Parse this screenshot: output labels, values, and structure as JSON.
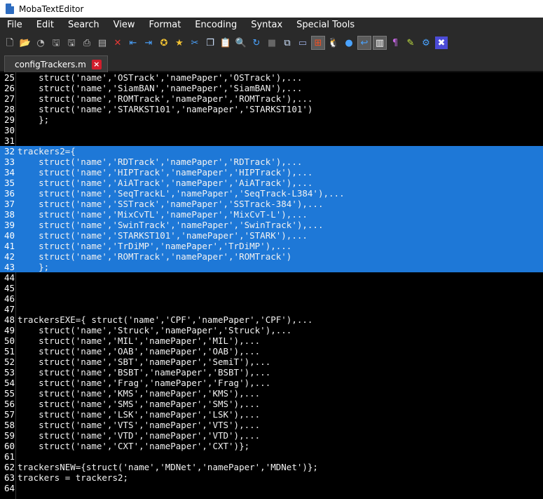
{
  "window": {
    "title": "MobaTextEditor"
  },
  "menu": [
    "File",
    "Edit",
    "Search",
    "View",
    "Format",
    "Encoding",
    "Syntax",
    "Special Tools"
  ],
  "toolbar": [
    {
      "name": "new-file-icon",
      "glyph": "🗋",
      "color": "#e8e8e8"
    },
    {
      "name": "open-folder-icon",
      "glyph": "📂",
      "color": "#e8b84a"
    },
    {
      "name": "reload-icon",
      "glyph": "◔",
      "color": "#bbbbbb"
    },
    {
      "name": "save-icon",
      "glyph": "🖫",
      "color": "#aaaaaa"
    },
    {
      "name": "save-all-icon",
      "glyph": "🖫",
      "color": "#bbbbbb"
    },
    {
      "name": "print-icon",
      "glyph": "⎙",
      "color": "#cccccc"
    },
    {
      "name": "print-preview-icon",
      "glyph": "▤",
      "color": "#bbbbbb"
    },
    {
      "name": "close-file-icon",
      "glyph": "✕",
      "color": "#e53935"
    },
    {
      "name": "unindent-icon",
      "glyph": "⇤",
      "color": "#4aa3ff"
    },
    {
      "name": "indent-icon",
      "glyph": "⇥",
      "color": "#4aa3ff"
    },
    {
      "name": "bookmark-toggle-icon",
      "glyph": "✪",
      "color": "#f2c233"
    },
    {
      "name": "bookmark-star-icon",
      "glyph": "★",
      "color": "#f2c233"
    },
    {
      "name": "cut-icon",
      "glyph": "✂",
      "color": "#4aa3ff"
    },
    {
      "name": "copy-icon",
      "glyph": "❐",
      "color": "#cfe3ff"
    },
    {
      "name": "paste-icon",
      "glyph": "📋",
      "color": "#d8c48a"
    },
    {
      "name": "find-icon",
      "glyph": "🔍",
      "color": "#cfe3ff"
    },
    {
      "name": "replace-icon",
      "glyph": "↻",
      "color": "#4aa3ff"
    },
    {
      "name": "goto-icon",
      "glyph": "■",
      "color": "#666666"
    },
    {
      "name": "compare-icon",
      "glyph": "⧉",
      "color": "#cfe3ff"
    },
    {
      "name": "view-mode-icon",
      "glyph": "▭",
      "color": "#9ad"
    },
    {
      "name": "windows-format-icon",
      "glyph": "⊞",
      "color": "#f25022",
      "active": true
    },
    {
      "name": "linux-format-icon",
      "glyph": "🐧",
      "color": "#ffffff"
    },
    {
      "name": "mac-format-icon",
      "glyph": "●",
      "color": "#4aa3ff"
    },
    {
      "name": "word-wrap-icon",
      "glyph": "↩",
      "color": "#4aa3ff",
      "active": true
    },
    {
      "name": "split-view-icon",
      "glyph": "▥",
      "color": "#ffffff",
      "active": true
    },
    {
      "name": "show-special-chars-icon",
      "glyph": "¶",
      "color": "#c266e0"
    },
    {
      "name": "highlight-icon",
      "glyph": "✎",
      "color": "#c0e040"
    },
    {
      "name": "settings-icon",
      "glyph": "⚙",
      "color": "#4aa3ff"
    },
    {
      "name": "exit-icon",
      "glyph": "✖",
      "color": "#ffffff",
      "bg": "#4b4bd6"
    }
  ],
  "tabs": [
    {
      "label": "configTrackers.m",
      "close": "×"
    }
  ],
  "editor": {
    "lines": [
      {
        "n": "25",
        "text": "    struct('name','OSTrack','namePaper','OSTrack'),...",
        "sel": false
      },
      {
        "n": "26",
        "text": "    struct('name','SiamBAN','namePaper','SiamBAN'),...",
        "sel": false
      },
      {
        "n": "27",
        "text": "    struct('name','ROMTrack','namePaper','ROMTrack'),...",
        "sel": false
      },
      {
        "n": "28",
        "text": "    struct('name','STARKST101','namePaper','STARKST101')",
        "sel": false
      },
      {
        "n": "29",
        "text": "    };",
        "sel": false
      },
      {
        "n": "30",
        "text": "",
        "sel": false
      },
      {
        "n": "31",
        "text": "",
        "sel": false
      },
      {
        "n": "32",
        "text": "trackers2={",
        "sel": true
      },
      {
        "n": "33",
        "text": "    struct('name','RDTrack','namePaper','RDTrack'),...",
        "sel": true
      },
      {
        "n": "34",
        "text": "    struct('name','HIPTrack','namePaper','HIPTrack'),...",
        "sel": true
      },
      {
        "n": "35",
        "text": "    struct('name','AiATrack','namePaper','AiATrack'),...",
        "sel": true
      },
      {
        "n": "36",
        "text": "    struct('name','SeqTrackL','namePaper','SeqTrack-L384'),...",
        "sel": true
      },
      {
        "n": "37",
        "text": "    struct('name','SSTrack','namePaper','SSTrack-384'),...",
        "sel": true
      },
      {
        "n": "38",
        "text": "    struct('name','MixCvTL','namePaper','MixCvT-L'),...",
        "sel": true
      },
      {
        "n": "39",
        "text": "    struct('name','SwinTrack','namePaper','SwinTrack'),...",
        "sel": true
      },
      {
        "n": "40",
        "text": "    struct('name','STARKST101','namePaper','STARK'),...",
        "sel": true
      },
      {
        "n": "41",
        "text": "    struct('name','TrDiMP','namePaper','TrDiMP'),...",
        "sel": true
      },
      {
        "n": "42",
        "text": "    struct('name','ROMTrack','namePaper','ROMTrack')",
        "sel": true
      },
      {
        "n": "43",
        "text": "    };",
        "sel": true
      },
      {
        "n": "44",
        "text": "",
        "sel": false
      },
      {
        "n": "45",
        "text": "",
        "sel": false
      },
      {
        "n": "46",
        "text": "",
        "sel": false
      },
      {
        "n": "47",
        "text": "",
        "sel": false
      },
      {
        "n": "48",
        "text": "trackersEXE={ struct('name','CPF','namePaper','CPF'),...",
        "sel": false
      },
      {
        "n": "49",
        "text": "    struct('name','Struck','namePaper','Struck'),...",
        "sel": false
      },
      {
        "n": "50",
        "text": "    struct('name','MIL','namePaper','MIL'),...",
        "sel": false
      },
      {
        "n": "51",
        "text": "    struct('name','OAB','namePaper','OAB'),...",
        "sel": false
      },
      {
        "n": "52",
        "text": "    struct('name','SBT','namePaper','SemiT'),...",
        "sel": false
      },
      {
        "n": "53",
        "text": "    struct('name','BSBT','namePaper','BSBT'),...",
        "sel": false
      },
      {
        "n": "54",
        "text": "    struct('name','Frag','namePaper','Frag'),...",
        "sel": false
      },
      {
        "n": "55",
        "text": "    struct('name','KMS','namePaper','KMS'),...",
        "sel": false
      },
      {
        "n": "56",
        "text": "    struct('name','SMS','namePaper','SMS'),...",
        "sel": false
      },
      {
        "n": "57",
        "text": "    struct('name','LSK','namePaper','LSK'),...",
        "sel": false
      },
      {
        "n": "58",
        "text": "    struct('name','VTS','namePaper','VTS'),...",
        "sel": false
      },
      {
        "n": "59",
        "text": "    struct('name','VTD','namePaper','VTD'),...",
        "sel": false
      },
      {
        "n": "60",
        "text": "    struct('name','CXT','namePaper','CXT')};",
        "sel": false
      },
      {
        "n": "61",
        "text": "",
        "sel": false
      },
      {
        "n": "62",
        "text": "trackersNEW={struct('name','MDNet','namePaper','MDNet')};",
        "sel": false
      },
      {
        "n": "63",
        "text": "trackers = trackers2;",
        "sel": false
      },
      {
        "n": "64",
        "text": "",
        "sel": false
      }
    ]
  }
}
